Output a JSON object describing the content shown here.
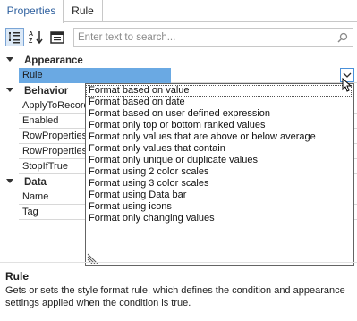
{
  "tabs": [
    {
      "label": "Properties",
      "active": true
    },
    {
      "label": "Rule",
      "active": false
    }
  ],
  "toolbar": {
    "buttons": [
      {
        "icon": "categorized-icon",
        "pressed": true
      },
      {
        "icon": "alphabetical-sort-icon",
        "pressed": false
      },
      {
        "icon": "property-pages-icon",
        "pressed": false
      }
    ],
    "search_placeholder": "Enter text to search..."
  },
  "grid": {
    "categories": [
      {
        "label": "Appearance",
        "rows": [
          {
            "name": "Rule",
            "value": "",
            "selected": true
          }
        ]
      },
      {
        "label": "Behavior",
        "rows": [
          {
            "name": "ApplyToRecord",
            "value": ""
          },
          {
            "name": "Enabled",
            "value": ""
          },
          {
            "name": "RowProperties",
            "value": ""
          },
          {
            "name": "RowProperties",
            "value": ""
          },
          {
            "name": "StopIfTrue",
            "value": ""
          }
        ]
      },
      {
        "label": "Data",
        "rows": [
          {
            "name": "Name",
            "value": ""
          },
          {
            "name": "Tag",
            "value": ""
          }
        ]
      }
    ]
  },
  "dropdown": {
    "highlighted_index": 0,
    "items": [
      "Format based on value",
      "Format based on date",
      "Format based on user defined expression",
      "Format only top or bottom ranked values",
      "Format only values that are above or below average",
      "Format only values that contain",
      "Format only unique or duplicate values",
      "Format using 2 color scales",
      "Format using 3 color scales",
      "Format using Data bar",
      "Format using icons",
      "Format only changing values"
    ]
  },
  "description": {
    "title": "Rule",
    "text": "Gets or sets the style format rule, which defines the condition and appearance settings applied when the condition is true."
  }
}
